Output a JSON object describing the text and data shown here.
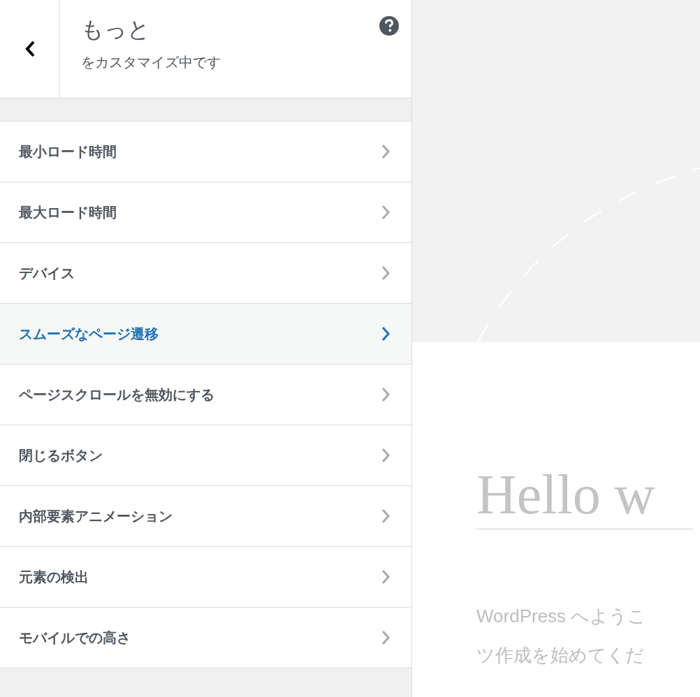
{
  "panel": {
    "title": "もっと",
    "subtitle": "をカスタマイズ中です"
  },
  "items": [
    {
      "label": "最小ロード時間",
      "selected": false
    },
    {
      "label": "最大ロード時間",
      "selected": false
    },
    {
      "label": "デバイス",
      "selected": false
    },
    {
      "label": "スムーズなページ遷移",
      "selected": true
    },
    {
      "label": "ページスクロールを無効にする",
      "selected": false
    },
    {
      "label": "閉じるボタン",
      "selected": false
    },
    {
      "label": "内部要素アニメーション",
      "selected": false
    },
    {
      "label": "元素の検出",
      "selected": false
    },
    {
      "label": "モバイルでの高さ",
      "selected": false
    }
  ],
  "preview": {
    "title": "Hello w",
    "lines": [
      "WordPress へようこ",
      "ツ作成を始めてくだ"
    ]
  }
}
